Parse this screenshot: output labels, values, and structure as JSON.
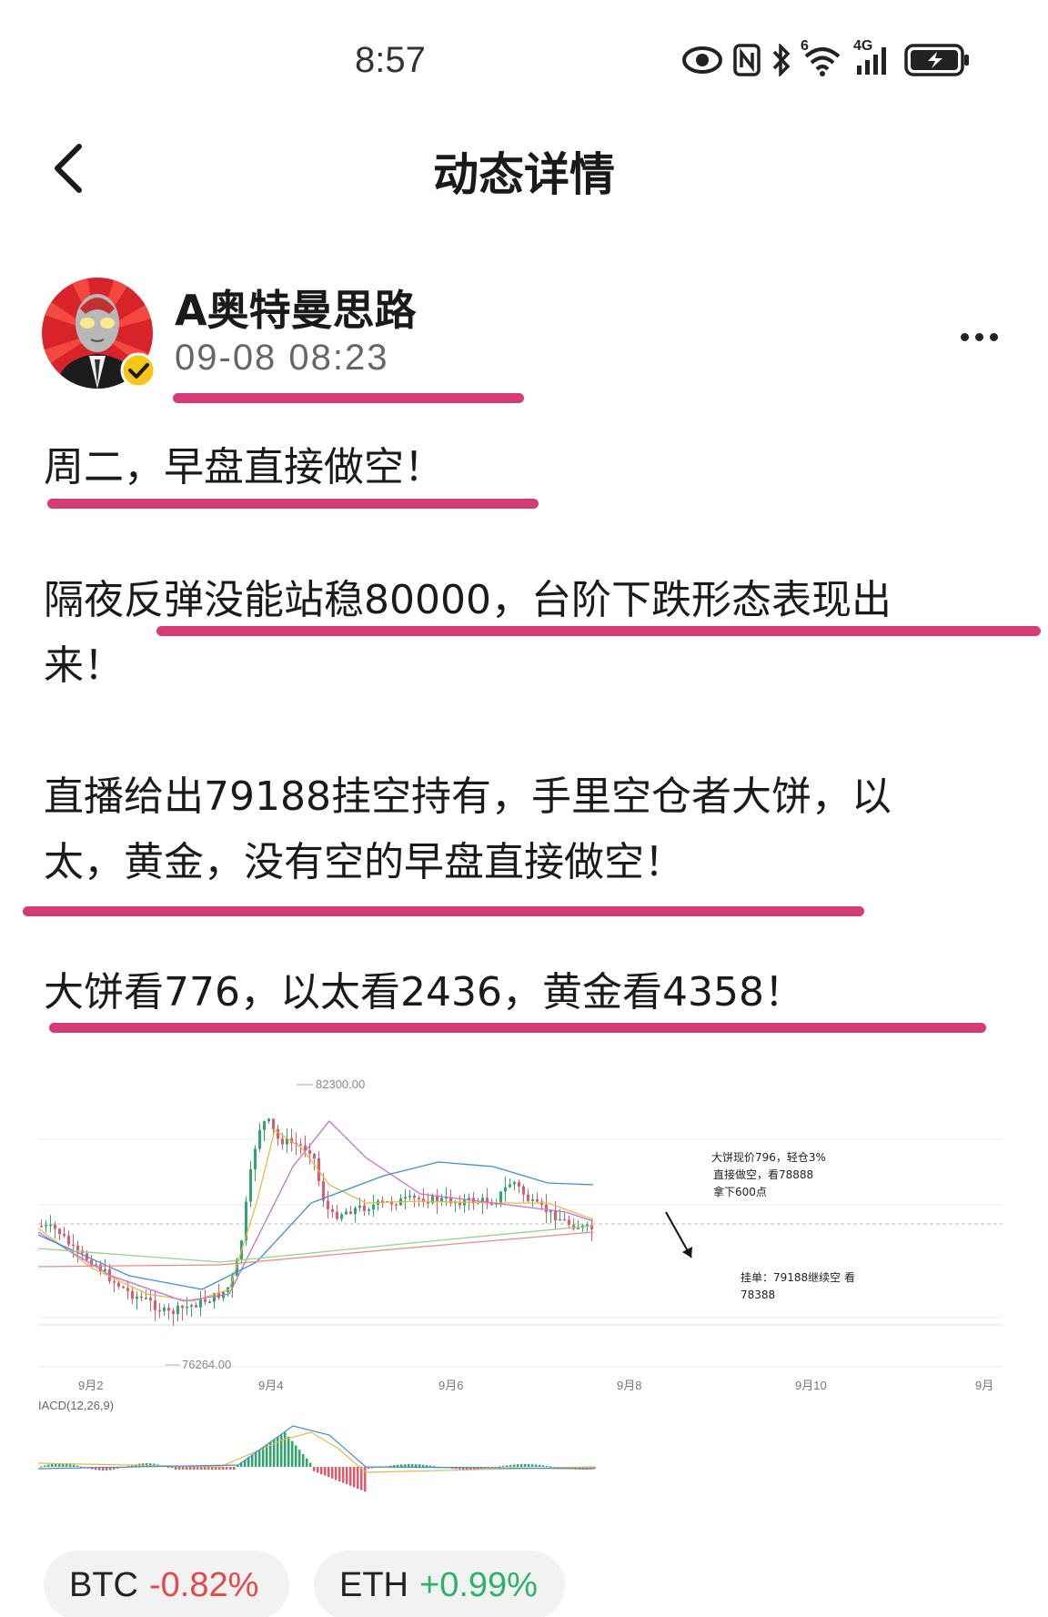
{
  "status_bar": {
    "time": "8:57",
    "icons": [
      "eye-icon",
      "nfc-icon",
      "bluetooth-icon",
      "wifi-icon",
      "signal-icon",
      "battery-charging-icon"
    ],
    "wifi_badge": "6",
    "network": "4G"
  },
  "header": {
    "title": "动态详情",
    "back_icon": "chevron-left-icon"
  },
  "author": {
    "name": "A奥特曼思路",
    "time": "09-08 08:23",
    "verified": true
  },
  "post": {
    "p1": "周二，早盘直接做空！",
    "p2": "隔夜反弹没能站稳80000，台阶下跌形态表现出来！",
    "p3": "直播给出79188挂空持有，手里空仓者大饼，以太，黄金，没有空的早盘直接做空！",
    "p4": "大饼看776，以太看2436，黄金看4358！"
  },
  "highlight_color": "#d63a78",
  "chart_data": {
    "type": "candlestick",
    "x_labels": [
      "9月2",
      "9月4",
      "9月6",
      "9月8",
      "9月10",
      "9月"
    ],
    "high_label": "82300.00",
    "low_label": "76264.00",
    "annotation_1": [
      "大饼现价796，轻仓3%",
      "直接做空，看78888",
      "拿下600点"
    ],
    "annotation_2": [
      "挂单：79188继续空 看",
      "78388"
    ],
    "indicator_label": "IACD(12,26,9)",
    "up_color": "#2ea86a",
    "down_color": "#e05a6a"
  },
  "coins": [
    {
      "symbol": "BTC",
      "change": "-0.82%"
    },
    {
      "symbol": "ETH",
      "change": "+0.99%"
    }
  ]
}
